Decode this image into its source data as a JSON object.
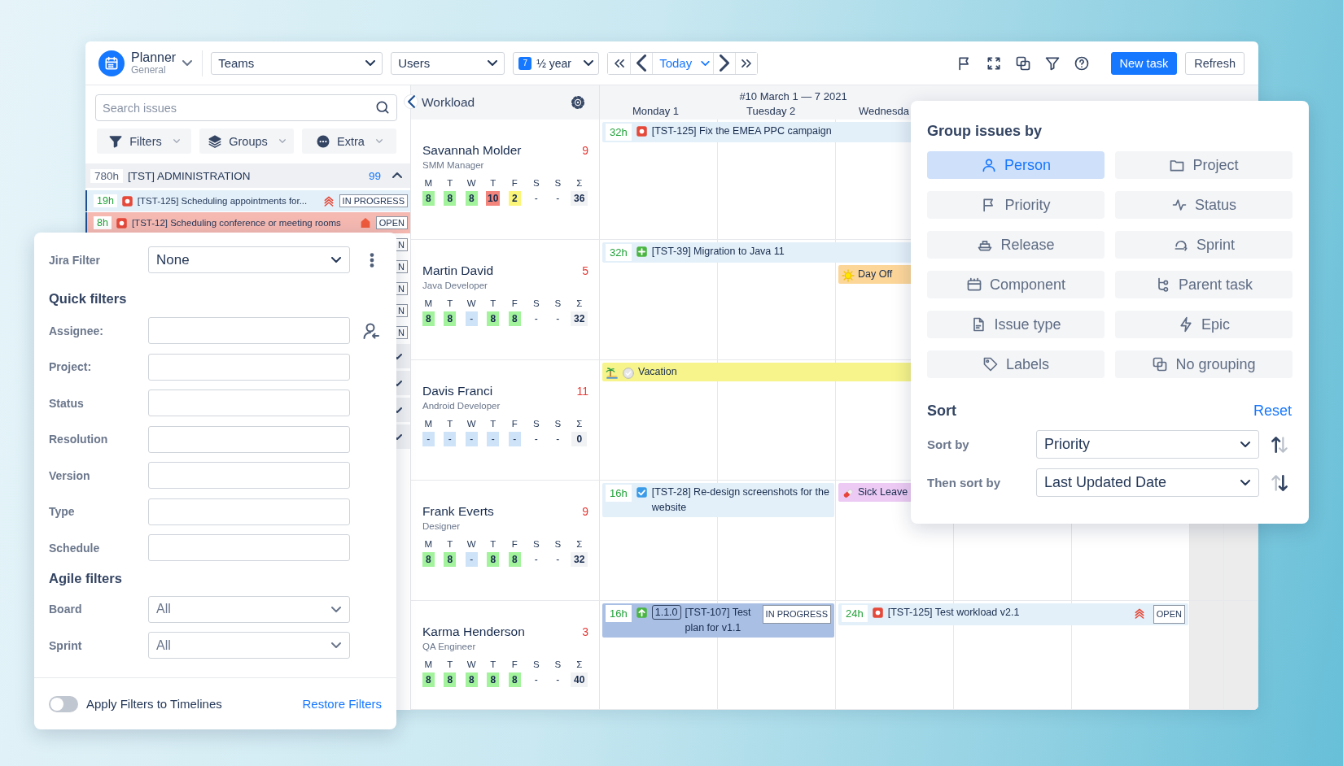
{
  "toolbar": {
    "app_name": "Planner",
    "app_subtitle": "General",
    "selects": [
      {
        "value": "Teams"
      },
      {
        "value": "Users"
      }
    ],
    "period": {
      "day": "7",
      "value": "½ year"
    },
    "today": "Today",
    "new_task": "New task",
    "refresh": "Refresh"
  },
  "left_panel": {
    "search": {
      "placeholder": "Search issues"
    },
    "buttons": [
      {
        "label": "Filters",
        "kind": "filter"
      },
      {
        "label": "Groups",
        "kind": "layers"
      },
      {
        "label": "Extra",
        "kind": "more"
      }
    ],
    "groups": [
      {
        "hours": "780h",
        "title": "[TST] ADMINISTRATION",
        "count": "99",
        "expanded": true,
        "issues": [
          {
            "hours": "19h",
            "icon": {
              "kind": "bug"
            },
            "title": "[TST-125] Scheduling appointments for...",
            "priority": {
              "kind": "highest"
            },
            "status": "IN PROGRESS",
            "color": "#e3f0f9"
          },
          {
            "hours": "8h",
            "icon": {
              "kind": "bug"
            },
            "title": "[TST-12] Scheduling conference or meeting rooms",
            "priority": {
              "kind": "blocker"
            },
            "status": "OPEN",
            "color": "#f5b9b2"
          },
          {
            "status": "N"
          },
          {
            "status": "N"
          },
          {
            "status": "N"
          },
          {
            "status": "N"
          },
          {
            "status": "N"
          }
        ]
      },
      {
        "expanded": false
      },
      {
        "expanded": false
      },
      {
        "expanded": false
      },
      {
        "expanded": false
      }
    ]
  },
  "workload": {
    "title": "Workload"
  },
  "calendar": {
    "week": "#10 March 1 — 7 2021",
    "days": [
      "Monday 1",
      "Tuesday 2",
      "Wednesda"
    ]
  },
  "people": [
    {
      "name": "Savannah Molder",
      "role": "SMM Manager",
      "count": "9",
      "days": [
        {
          "letter": "M",
          "value": "8",
          "kind": "ok"
        },
        {
          "letter": "T",
          "value": "8",
          "kind": "ok"
        },
        {
          "letter": "W",
          "value": "8",
          "kind": "ok"
        },
        {
          "letter": "T",
          "value": "10",
          "kind": "over"
        },
        {
          "letter": "F",
          "value": "2",
          "kind": "under"
        },
        {
          "letter": "S",
          "value": "-",
          "kind": "none"
        },
        {
          "letter": "S",
          "value": "-",
          "kind": "none"
        },
        {
          "letter": "Σ",
          "value": "36",
          "kind": "total"
        }
      ],
      "events": [
        {
          "kind": "issue",
          "hours": "32h",
          "icon": {
            "kind": "bug"
          },
          "title": "[TST-125] Fix the EMEA PPC campaign",
          "from": {
            "kind": "Mon"
          },
          "to": {
            "kind": "Thu"
          },
          "color": "#e3f0f9"
        }
      ]
    },
    {
      "name": "Martin David",
      "role": "Java Developer",
      "count": "5",
      "days": [
        {
          "letter": "M",
          "value": "8",
          "kind": "ok"
        },
        {
          "letter": "T",
          "value": "8",
          "kind": "ok"
        },
        {
          "letter": "W",
          "value": "-",
          "kind": "off"
        },
        {
          "letter": "T",
          "value": "8",
          "kind": "ok"
        },
        {
          "letter": "F",
          "value": "8",
          "kind": "ok"
        },
        {
          "letter": "S",
          "value": "-",
          "kind": "none"
        },
        {
          "letter": "S",
          "value": "-",
          "kind": "none"
        },
        {
          "letter": "Σ",
          "value": "32",
          "kind": "total"
        }
      ],
      "events": [
        {
          "kind": "issue",
          "hours": "32h",
          "icon": {
            "kind": "feature"
          },
          "title": "[TST-39] Migration to Java 11",
          "from": {
            "kind": "Mon"
          },
          "to": {
            "kind": "Thu"
          },
          "color": "#e3f0f9"
        },
        {
          "kind": "day_off",
          "title": "Day Off",
          "from": {
            "kind": "Wed"
          },
          "to": {
            "kind": "Wed"
          },
          "color": "#fcd699"
        }
      ]
    },
    {
      "name": "Davis Franci",
      "role": "Android Developer",
      "count": "11",
      "days": [
        {
          "letter": "M",
          "value": "-",
          "kind": "off"
        },
        {
          "letter": "T",
          "value": "-",
          "kind": "off"
        },
        {
          "letter": "W",
          "value": "-",
          "kind": "off"
        },
        {
          "letter": "T",
          "value": "-",
          "kind": "off"
        },
        {
          "letter": "F",
          "value": "-",
          "kind": "off"
        },
        {
          "letter": "S",
          "value": "-",
          "kind": "none"
        },
        {
          "letter": "S",
          "value": "-",
          "kind": "none"
        },
        {
          "letter": "Σ",
          "value": "0",
          "kind": "total"
        }
      ],
      "events": [
        {
          "kind": "vacation",
          "title": "Vacation",
          "from": {
            "kind": "Mon"
          },
          "to": {
            "kind": "Thu"
          },
          "color": "#f6f48a"
        }
      ]
    },
    {
      "name": "Frank Everts",
      "role": "Designer",
      "count": "9",
      "days": [
        {
          "letter": "M",
          "value": "8",
          "kind": "ok"
        },
        {
          "letter": "T",
          "value": "8",
          "kind": "ok"
        },
        {
          "letter": "W",
          "value": "-",
          "kind": "off"
        },
        {
          "letter": "T",
          "value": "8",
          "kind": "ok"
        },
        {
          "letter": "F",
          "value": "8",
          "kind": "ok"
        },
        {
          "letter": "S",
          "value": "-",
          "kind": "none"
        },
        {
          "letter": "S",
          "value": "-",
          "kind": "none"
        },
        {
          "letter": "Σ",
          "value": "32",
          "kind": "total"
        }
      ],
      "events": [
        {
          "kind": "issue",
          "hours": "16h",
          "icon": {
            "kind": "task"
          },
          "title": "[TST-28] Re-design screenshots for the website",
          "from": {
            "kind": "Mon"
          },
          "to": {
            "kind": "Tue"
          },
          "color": "#e3f0f9"
        },
        {
          "kind": "sick_leave",
          "title": "Sick Leave",
          "from": {
            "kind": "Wed"
          },
          "to": {
            "kind": "Wed"
          },
          "color": "#eccaf3"
        }
      ]
    },
    {
      "name": "Karma Henderson",
      "role": "QA Engineer",
      "count": "3",
      "days": [
        {
          "letter": "M",
          "value": "8",
          "kind": "ok"
        },
        {
          "letter": "T",
          "value": "8",
          "kind": "ok"
        },
        {
          "letter": "W",
          "value": "8",
          "kind": "ok"
        },
        {
          "letter": "T",
          "value": "8",
          "kind": "ok"
        },
        {
          "letter": "F",
          "value": "8",
          "kind": "ok"
        },
        {
          "letter": "S",
          "value": "-",
          "kind": "none"
        },
        {
          "letter": "S",
          "value": "-",
          "kind": "none"
        },
        {
          "letter": "Σ",
          "value": "40",
          "kind": "total"
        }
      ],
      "events": [
        {
          "kind": "issue",
          "hours": "16h",
          "icon": {
            "kind": "improvement"
          },
          "version": "1.1.0",
          "title": "[TST-107] Test plan for v1.1",
          "status": "IN PROGRESS",
          "from": {
            "kind": "Mon"
          },
          "to": {
            "kind": "Tue"
          },
          "color": "#a9bfe4"
        },
        {
          "kind": "issue",
          "hours": "24h",
          "icon": {
            "kind": "bug"
          },
          "title": "[TST-125] Test workload v2.1",
          "priority": {
            "kind": "highest"
          },
          "status": "OPEN",
          "from": {
            "kind": "Wed"
          },
          "to": {
            "kind": "Fri"
          },
          "color": "#e3f0f9"
        }
      ]
    }
  ],
  "filter_panel": {
    "jira_filter": {
      "label": "Jira Filter",
      "value": "None"
    },
    "quick_title": "Quick filters",
    "fields": [
      {
        "label": "Assignee:",
        "kind": "user"
      },
      {
        "label": "Project:",
        "kind": "text"
      },
      {
        "label": "Status",
        "kind": "text"
      },
      {
        "label": "Resolution",
        "kind": "text"
      },
      {
        "label": "Version",
        "kind": "text"
      },
      {
        "label": "Type",
        "kind": "text"
      },
      {
        "label": "Schedule",
        "kind": "text"
      }
    ],
    "agile_title": "Agile filters",
    "selects": [
      {
        "label": "Board",
        "value": "All"
      },
      {
        "label": "Sprint",
        "value": "All"
      }
    ],
    "toggle": {
      "label": "Apply Filters to Timelines",
      "on": false
    },
    "restore": "Restore Filters"
  },
  "group_panel": {
    "title": "Group issues by",
    "options": [
      {
        "label": "Person",
        "kind": "person",
        "selected": true
      },
      {
        "label": "Project",
        "kind": "folder",
        "selected": false
      },
      {
        "label": "Priority",
        "kind": "flag",
        "selected": false
      },
      {
        "label": "Status",
        "kind": "activity",
        "selected": false
      },
      {
        "label": "Release",
        "kind": "ship",
        "selected": false
      },
      {
        "label": "Sprint",
        "kind": "loop",
        "selected": false
      },
      {
        "label": "Component",
        "kind": "component",
        "selected": false
      },
      {
        "label": "Parent task",
        "kind": "tree",
        "selected": false
      },
      {
        "label": "Issue type",
        "kind": "document",
        "selected": false
      },
      {
        "label": "Epic",
        "kind": "bolt",
        "selected": false
      },
      {
        "label": "Labels",
        "kind": "tag",
        "selected": false
      },
      {
        "label": "No grouping",
        "kind": "overlap",
        "selected": false
      }
    ],
    "sort": {
      "title": "Sort",
      "reset": "Reset",
      "rows": [
        {
          "label": "Sort by",
          "value": "Priority",
          "kind": "asc"
        },
        {
          "label": "Then sort by",
          "value": "Last Updated Date",
          "kind": "desc"
        }
      ]
    }
  }
}
